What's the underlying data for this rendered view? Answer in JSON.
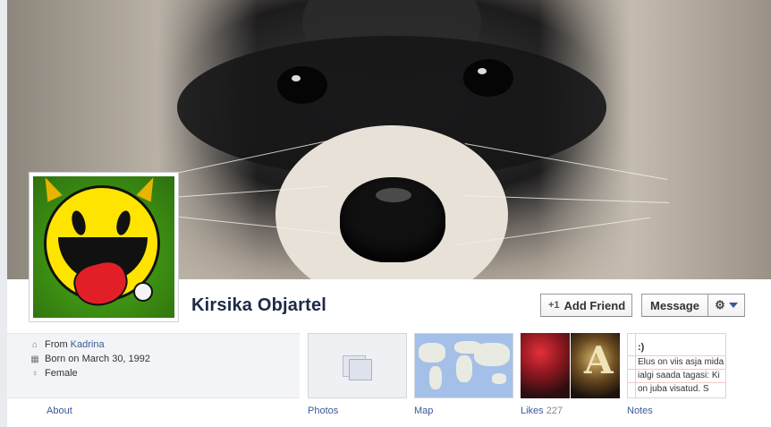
{
  "profile": {
    "name": "Kirsika Objartel",
    "cover_image": "raccoon-face-closeup",
    "avatar_image": "yellow-devil-smiley-with-tongue"
  },
  "actions": {
    "add_friend": "Add Friend",
    "add_friend_icon": "+1",
    "message": "Message",
    "gear_icon": "⚙"
  },
  "about": {
    "from_label": "From",
    "from_value": "Kadrina",
    "born": "Born on March 30, 1992",
    "gender": "Female",
    "icons": {
      "from": "house-icon",
      "born": "calendar-icon",
      "gender": "gender-icon"
    }
  },
  "tabs": {
    "about": "About",
    "photos": "Photos",
    "map": "Map",
    "likes": "Likes",
    "likes_count": "227",
    "notes": "Notes"
  },
  "notes_preview": {
    "title": ":)",
    "lines": [
      "Elus on viis asja mida",
      "ialgi saada tagasi: Ki",
      "on juba visatud. S"
    ]
  },
  "likes_preview": {
    "second_letter": "A"
  },
  "colors": {
    "link": "#3b5998",
    "name": "#1c2a47",
    "page_bg": "#e9ebee"
  }
}
